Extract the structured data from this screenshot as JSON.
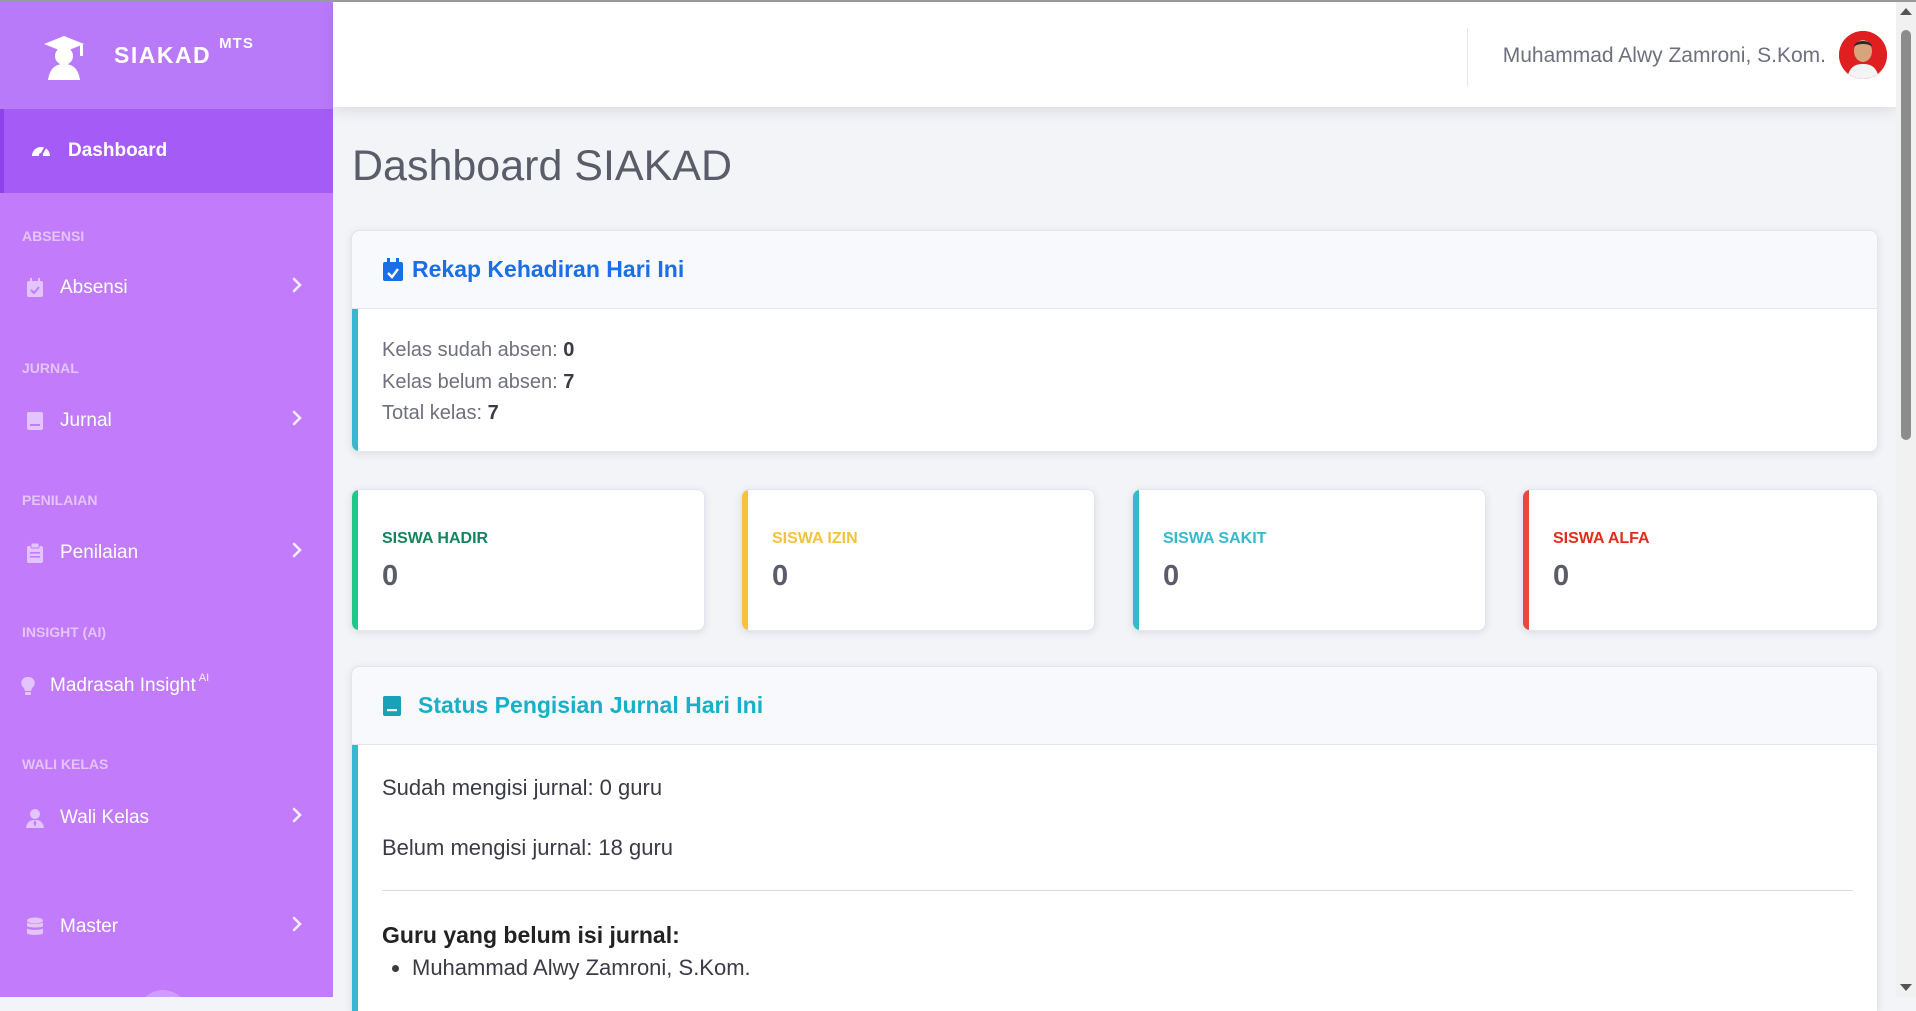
{
  "brand": {
    "name": "SIAKAD",
    "sup": "MTS",
    "logo_icon": "graduate-cap-icon"
  },
  "sidebar": {
    "active": {
      "label": "Dashboard",
      "icon": "tachometer-icon"
    },
    "sections": [
      {
        "heading": "Absensi",
        "item": "Absensi",
        "icon": "calendar-check-icon",
        "has_chevron": true
      },
      {
        "heading": "Jurnal",
        "item": "Jurnal",
        "icon": "book-icon",
        "has_chevron": true
      },
      {
        "heading": "Penilaian",
        "item": "Penilaian",
        "icon": "clipboard-icon",
        "has_chevron": true
      },
      {
        "heading": "Insight (AI)",
        "item": "Madrasah Insight",
        "item_sup": "AI",
        "icon": "lightbulb-icon",
        "has_chevron": false
      },
      {
        "heading": "Wali Kelas",
        "item": "Wali Kelas",
        "icon": "user-tie-icon",
        "has_chevron": true
      },
      {
        "heading": "",
        "item": "Master",
        "icon": "database-icon",
        "has_chevron": true
      }
    ]
  },
  "topbar": {
    "user_name": "Muhammad Alwy Zamroni, S.Kom."
  },
  "page": {
    "title": "Dashboard SIAKAD"
  },
  "rekap": {
    "title": "Rekap Kehadiran Hari Ini",
    "sudah_label": "Kelas sudah absen:",
    "sudah_value": "0",
    "belum_label": "Kelas belum absen:",
    "belum_value": "7",
    "total_label": "Total kelas:",
    "total_value": "7"
  },
  "stats": [
    {
      "label": "Siswa Hadir",
      "value": "0",
      "color": "#1cc88a",
      "text_color": "#13855c"
    },
    {
      "label": "Siswa Izin",
      "value": "0",
      "color": "#f6c23e",
      "text_color": "#f6c23e"
    },
    {
      "label": "Siswa Sakit",
      "value": "0",
      "color": "#36b9cc",
      "text_color": "#36b9cc"
    },
    {
      "label": "Siswa Alfa",
      "value": "0",
      "color": "#e74a3b",
      "text_color": "#e02d1b"
    }
  ],
  "jurnal": {
    "title": "Status Pengisian Jurnal Hari Ini",
    "sudah": "Sudah mengisi jurnal: 0 guru",
    "belum": "Belum mengisi jurnal: 18 guru",
    "list_title": "Guru yang belum isi jurnal:",
    "guru": [
      "Muhammad Alwy Zamroni, S.Kom."
    ]
  },
  "colors": {
    "sidebar": "#c27cfb",
    "sidebar_active": "#a55cf6",
    "primary": "#1a6fe8",
    "info": "#17a2b8"
  }
}
